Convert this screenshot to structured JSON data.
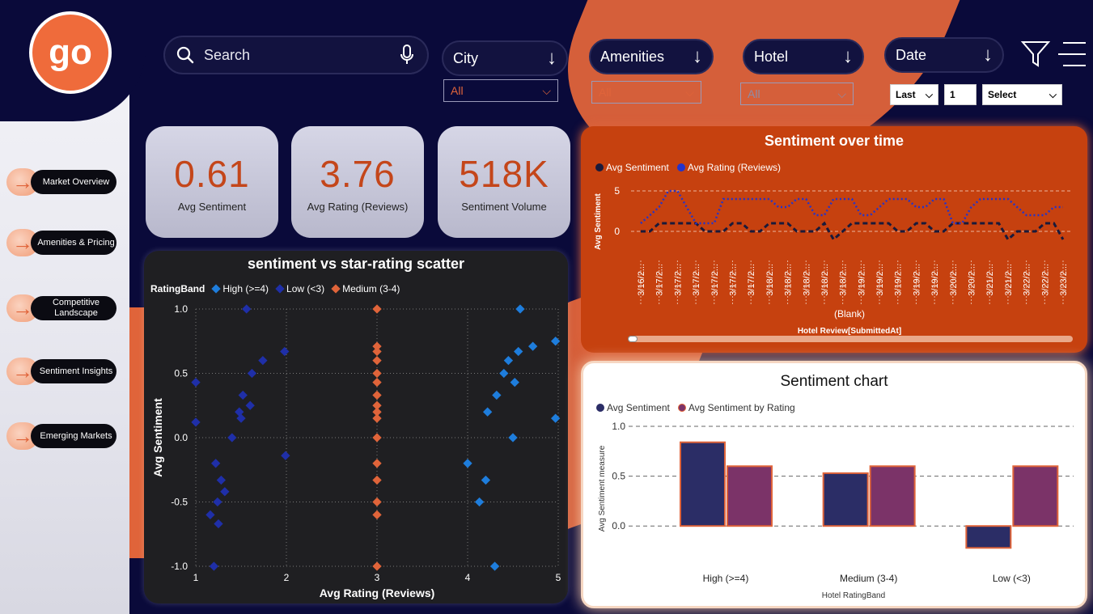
{
  "logo": {
    "text": "go"
  },
  "nav": [
    {
      "label": "Market Overview"
    },
    {
      "label": "Amenities & Pricing"
    },
    {
      "label": "Competitive Landscape"
    },
    {
      "label": "Sentiment Insights"
    },
    {
      "label": "Emerging Markets"
    }
  ],
  "search": {
    "placeholder": "Search"
  },
  "filters": {
    "city": {
      "label": "City",
      "value": "All"
    },
    "amenities": {
      "label": "Amenities",
      "value": "All"
    },
    "hotel": {
      "label": "Hotel",
      "value": "All"
    },
    "date": {
      "label": "Date",
      "relative": "Last",
      "count": "1",
      "unit": "Select"
    }
  },
  "kpis": [
    {
      "value": "0.61",
      "label": "Avg Sentiment"
    },
    {
      "value": "3.76",
      "label": "Avg Rating (Reviews)"
    },
    {
      "value": "518K",
      "label": "Sentiment Volume"
    }
  ],
  "colors": {
    "accent": "#e0643a",
    "navy": "#0a0a3a",
    "kpi_value": "#c4461a",
    "high": "#1e7ddc",
    "low": "#1f2fa8",
    "medium": "#e0643a"
  },
  "chart_data": [
    {
      "type": "scatter",
      "title": "sentiment vs star-rating scatter",
      "xlabel": "Avg Rating (Reviews)",
      "ylabel": "Avg Sentiment",
      "legend_title": "RatingBand",
      "xlim": [
        1,
        5
      ],
      "ylim": [
        -1.0,
        1.0
      ],
      "xticks": [
        "1",
        "2",
        "3",
        "4",
        "5"
      ],
      "yticks": [
        "1.0",
        "0.5",
        "0.0",
        "-0.5",
        "-1.0"
      ],
      "series": [
        {
          "name": "High (>=4)",
          "color": "#1e7ddc",
          "points": [
            [
              4.0,
              -0.2
            ],
            [
              4.13,
              -0.5
            ],
            [
              4.2,
              -0.33
            ],
            [
              4.22,
              0.2
            ],
            [
              4.32,
              0.33
            ],
            [
              4.4,
              0.5
            ],
            [
              4.45,
              0.6
            ],
            [
              4.52,
              0.43
            ],
            [
              4.56,
              0.67
            ],
            [
              4.5,
              0.0
            ],
            [
              4.58,
              1.0
            ],
            [
              4.72,
              0.71
            ],
            [
              4.97,
              0.75
            ],
            [
              4.97,
              0.15
            ],
            [
              4.3,
              -1.0
            ]
          ]
        },
        {
          "name": "Low (<3)",
          "color": "#1f2fa8",
          "points": [
            [
              1.0,
              0.43
            ],
            [
              1.0,
              0.12
            ],
            [
              1.16,
              -0.6
            ],
            [
              1.2,
              -1.0
            ],
            [
              1.22,
              -0.2
            ],
            [
              1.24,
              -0.5
            ],
            [
              1.25,
              -0.67
            ],
            [
              1.28,
              -0.33
            ],
            [
              1.32,
              -0.42
            ],
            [
              1.4,
              0.0
            ],
            [
              1.48,
              0.2
            ],
            [
              1.5,
              0.15
            ],
            [
              1.52,
              0.33
            ],
            [
              1.56,
              1.0
            ],
            [
              1.6,
              0.25
            ],
            [
              1.62,
              0.5
            ],
            [
              1.74,
              0.6
            ],
            [
              1.98,
              0.67
            ],
            [
              1.99,
              -0.14
            ]
          ]
        },
        {
          "name": "Medium (3-4)",
          "color": "#e0643a",
          "points": [
            [
              3,
              1.0
            ],
            [
              3,
              0.71
            ],
            [
              3,
              0.67
            ],
            [
              3,
              0.6
            ],
            [
              3,
              0.5
            ],
            [
              3,
              0.43
            ],
            [
              3,
              0.33
            ],
            [
              3,
              0.25
            ],
            [
              3,
              0.2
            ],
            [
              3,
              0.15
            ],
            [
              3,
              0.0
            ],
            [
              3,
              -0.2
            ],
            [
              3,
              -0.33
            ],
            [
              3,
              -0.5
            ],
            [
              3,
              -0.6
            ],
            [
              3,
              -1.0
            ]
          ]
        }
      ]
    },
    {
      "type": "line",
      "title": "Sentiment over time",
      "xlabel": "(Blank)",
      "xlabel2": "Hotel Review[SubmittedAt]",
      "ylabel": "Avg Sentiment",
      "ylim": [
        -1,
        6
      ],
      "yticks": [
        "5",
        "0"
      ],
      "categories": [
        "3/16/2...",
        "3/17/2...",
        "3/17/2...",
        "3/17/2...",
        "3/17/2...",
        "3/17/2...",
        "3/17/2...",
        "3/18/2...",
        "3/18/2...",
        "3/18/2...",
        "3/18/2...",
        "3/18/2...",
        "3/19/2...",
        "3/19/2...",
        "3/19/2...",
        "3/19/2...",
        "3/19/2...",
        "3/20/2...",
        "3/20/2...",
        "3/21/2...",
        "3/21/2...",
        "3/22/2...",
        "3/22/2...",
        "3/23/2..."
      ],
      "x_count": 47,
      "series": [
        {
          "name": "Avg Sentiment",
          "color": "#1a1a3a",
          "values": [
            0,
            0,
            1,
            1,
            1,
            1,
            1,
            0,
            0,
            0,
            1,
            1,
            0,
            0,
            1,
            1,
            1,
            0,
            0,
            0,
            1,
            -1,
            0,
            1,
            1,
            1,
            1,
            1,
            0,
            0,
            1,
            1,
            0,
            0,
            1,
            1,
            1,
            1,
            1,
            1,
            -1,
            0,
            0,
            0,
            1,
            1,
            -1
          ]
        },
        {
          "name": "Avg Rating (Reviews)",
          "color": "#2233cc",
          "values": [
            1,
            2,
            3,
            5,
            5,
            3,
            1,
            1,
            1,
            4,
            4,
            4,
            4,
            4,
            4,
            3,
            3,
            4,
            4,
            2,
            2,
            4,
            4,
            4,
            2,
            2,
            3,
            4,
            4,
            4,
            3,
            3,
            4,
            4,
            1,
            1,
            3,
            4,
            4,
            4,
            4,
            3,
            2,
            2,
            2,
            3,
            3
          ]
        }
      ]
    },
    {
      "type": "bar",
      "title": "Sentiment chart",
      "xlabel": "Hotel RatingBand",
      "ylabel": "Avg Sentiment measure",
      "ylim": [
        -0.25,
        1.0
      ],
      "yticks": [
        "1.0",
        "0.5",
        "0.0"
      ],
      "categories": [
        "High (>=4)",
        "Medium (3-4)",
        "Low (<3)"
      ],
      "series": [
        {
          "name": "Avg Sentiment",
          "color": "#2b2d66",
          "values": [
            0.84,
            0.53,
            -0.22
          ]
        },
        {
          "name": "Avg Sentiment by Rating",
          "color": "#7b3368",
          "values": [
            0.6,
            0.6,
            0.6
          ]
        }
      ]
    }
  ]
}
